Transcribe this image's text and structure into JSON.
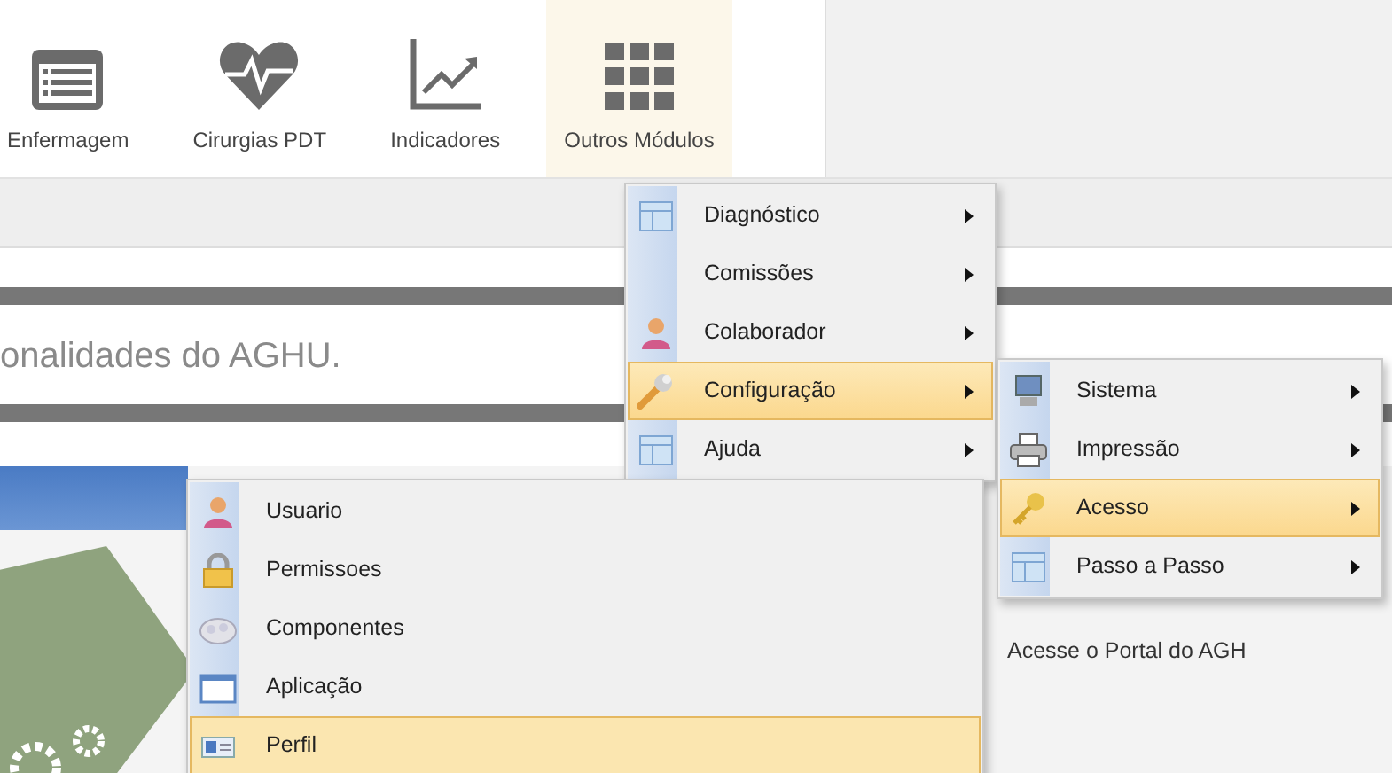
{
  "toolbar": [
    {
      "label": "Enfermagem",
      "selected": false
    },
    {
      "label": "Cirurgias PDT",
      "selected": false
    },
    {
      "label": "Indicadores",
      "selected": false
    },
    {
      "label": "Outros Módulos",
      "selected": true
    }
  ],
  "page": {
    "intro_text": "onalidades do AGHU.",
    "portal_text": "Acesse o Portal do AGH"
  },
  "menus": [
    {
      "items": [
        {
          "label": "Diagnóstico",
          "has_submenu": true,
          "selected": false
        },
        {
          "label": "Comissões",
          "has_submenu": true,
          "selected": false
        },
        {
          "label": "Colaborador",
          "has_submenu": true,
          "selected": false
        },
        {
          "label": "Configuração",
          "has_submenu": true,
          "selected": true
        },
        {
          "label": "Ajuda",
          "has_submenu": true,
          "selected": false
        }
      ]
    },
    {
      "items": [
        {
          "label": "Sistema",
          "has_submenu": true,
          "selected": false
        },
        {
          "label": "Impressão",
          "has_submenu": true,
          "selected": false
        },
        {
          "label": "Acesso",
          "has_submenu": true,
          "selected": true
        },
        {
          "label": "Passo a Passo",
          "has_submenu": true,
          "selected": false
        }
      ]
    },
    {
      "items": [
        {
          "label": "Usuario",
          "has_submenu": false,
          "selected": false
        },
        {
          "label": "Permissoes",
          "has_submenu": false,
          "selected": false
        },
        {
          "label": "Componentes",
          "has_submenu": false,
          "selected": false
        },
        {
          "label": "Aplicação",
          "has_submenu": false,
          "selected": false
        },
        {
          "label": "Perfil",
          "has_submenu": false,
          "selected": true
        }
      ]
    }
  ]
}
